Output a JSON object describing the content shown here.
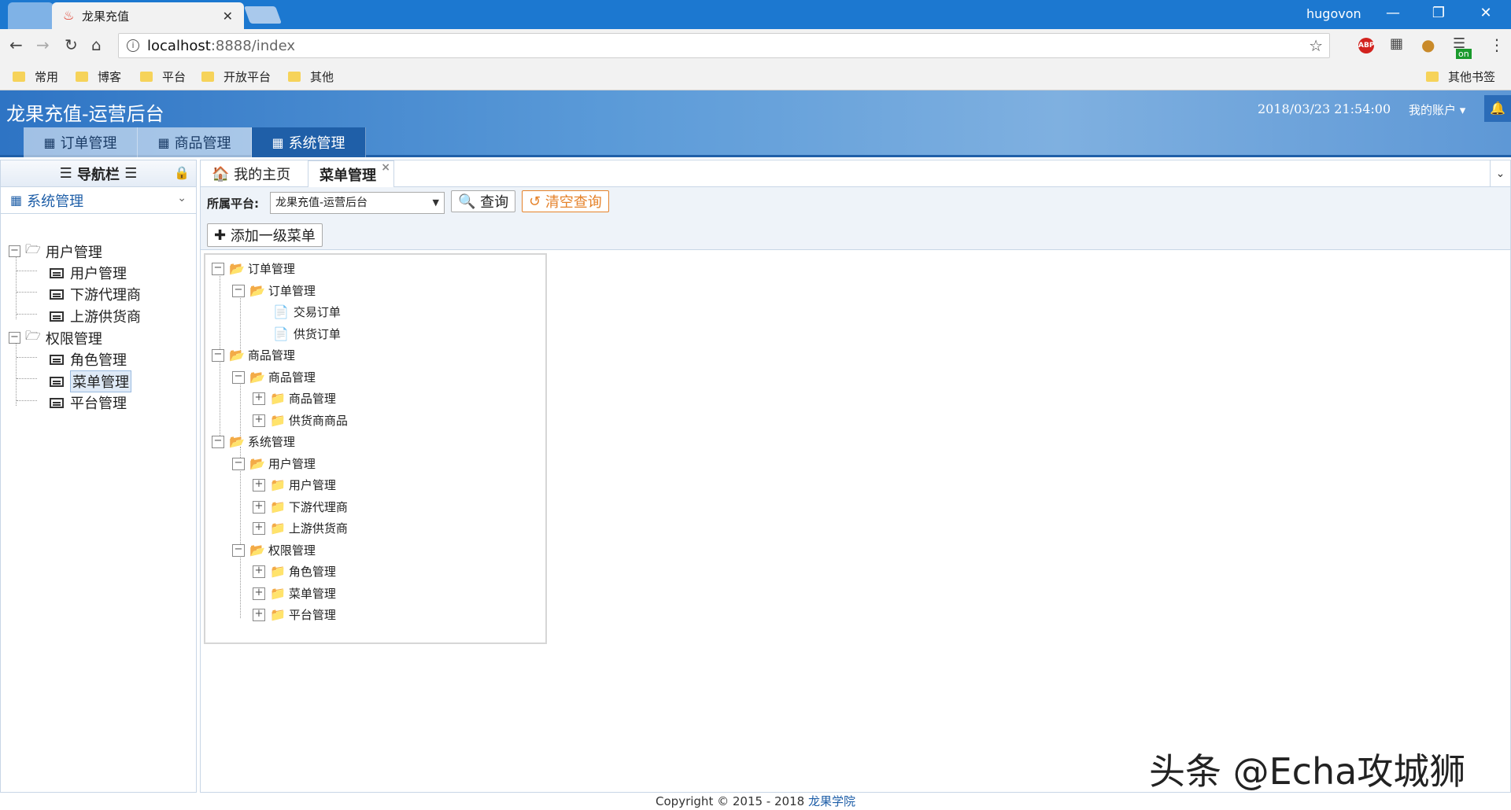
{
  "browser": {
    "tab_title": "龙果充值",
    "user": "hugovon",
    "address_host": "localhost",
    "address_path": ":8888/index",
    "bookmarks": [
      "常用",
      "博客",
      "平台",
      "开放平台",
      "其他"
    ],
    "other_bookmarks": "其他书签",
    "ext_abp": "ABP",
    "ext_on": "on"
  },
  "app": {
    "title": "龙果充值-运营后台",
    "datetime": "2018/03/23 21:54:00",
    "account": "我的账户",
    "main_tabs": [
      "订单管理",
      "商品管理",
      "系统管理"
    ]
  },
  "sidebar": {
    "header": "导航栏",
    "selected_module": "系统管理",
    "tree": [
      {
        "label": "用户管理",
        "children": [
          "用户管理",
          "下游代理商",
          "上游供货商"
        ]
      },
      {
        "label": "权限管理",
        "children": [
          "角色管理",
          "菜单管理",
          "平台管理"
        ]
      }
    ]
  },
  "content": {
    "tabs": [
      "我的主页",
      "菜单管理"
    ],
    "platform_label": "所属平台:",
    "platform_value": "龙果充值-运营后台",
    "query_label": "查询",
    "clear_label": "清空查询",
    "add_label": "添加一级菜单",
    "menu_tree": [
      "订单管理",
      "订单管理",
      "交易订单",
      "供货订单",
      "商品管理",
      "商品管理",
      "商品管理",
      "供货商商品",
      "系统管理",
      "用户管理",
      "用户管理",
      "下游代理商",
      "上游供货商",
      "权限管理",
      "角色管理",
      "菜单管理",
      "平台管理"
    ]
  },
  "watermark": "头条 @Echa攻城狮",
  "footer": {
    "copyright": "Copyright © 2015 - 2018",
    "link": "龙果学院"
  }
}
